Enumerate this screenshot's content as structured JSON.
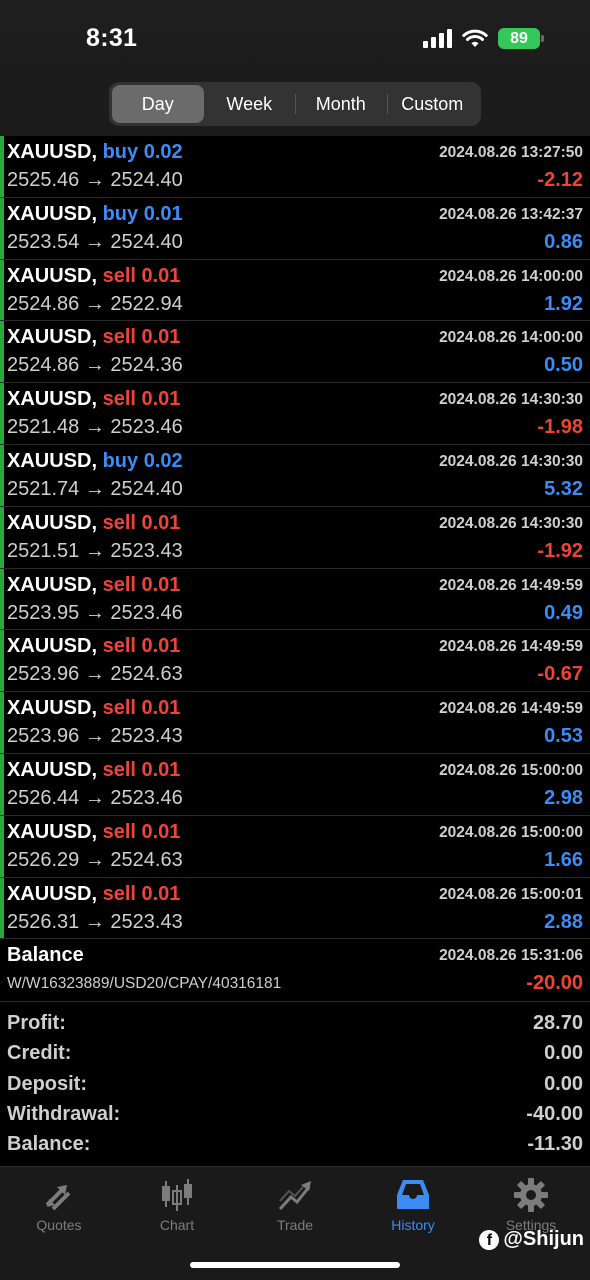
{
  "status_bar": {
    "time": "8:31",
    "battery": "89"
  },
  "period_tabs": [
    {
      "label": "Day",
      "active": true
    },
    {
      "label": "Week",
      "active": false
    },
    {
      "label": "Month",
      "active": false
    },
    {
      "label": "Custom",
      "active": false
    }
  ],
  "deals": [
    {
      "symbol": "XAUUSD,",
      "side": "buy",
      "volume": "0.02",
      "time": "2024.08.26 13:27:50",
      "prices": "2525.46 → 2524.40",
      "profit": "-2.12"
    },
    {
      "symbol": "XAUUSD,",
      "side": "buy",
      "volume": "0.01",
      "time": "2024.08.26 13:42:37",
      "prices": "2523.54 → 2524.40",
      "profit": "0.86"
    },
    {
      "symbol": "XAUUSD,",
      "side": "sell",
      "volume": "0.01",
      "time": "2024.08.26 14:00:00",
      "prices": "2524.86 → 2522.94",
      "profit": "1.92"
    },
    {
      "symbol": "XAUUSD,",
      "side": "sell",
      "volume": "0.01",
      "time": "2024.08.26 14:00:00",
      "prices": "2524.86 → 2524.36",
      "profit": "0.50"
    },
    {
      "symbol": "XAUUSD,",
      "side": "sell",
      "volume": "0.01",
      "time": "2024.08.26 14:30:30",
      "prices": "2521.48 → 2523.46",
      "profit": "-1.98"
    },
    {
      "symbol": "XAUUSD,",
      "side": "buy",
      "volume": "0.02",
      "time": "2024.08.26 14:30:30",
      "prices": "2521.74 → 2524.40",
      "profit": "5.32"
    },
    {
      "symbol": "XAUUSD,",
      "side": "sell",
      "volume": "0.01",
      "time": "2024.08.26 14:30:30",
      "prices": "2521.51 → 2523.43",
      "profit": "-1.92"
    },
    {
      "symbol": "XAUUSD,",
      "side": "sell",
      "volume": "0.01",
      "time": "2024.08.26 14:49:59",
      "prices": "2523.95 → 2523.46",
      "profit": "0.49"
    },
    {
      "symbol": "XAUUSD,",
      "side": "sell",
      "volume": "0.01",
      "time": "2024.08.26 14:49:59",
      "prices": "2523.96 → 2524.63",
      "profit": "-0.67"
    },
    {
      "symbol": "XAUUSD,",
      "side": "sell",
      "volume": "0.01",
      "time": "2024.08.26 14:49:59",
      "prices": "2523.96 → 2523.43",
      "profit": "0.53"
    },
    {
      "symbol": "XAUUSD,",
      "side": "sell",
      "volume": "0.01",
      "time": "2024.08.26 15:00:00",
      "prices": "2526.44 → 2523.46",
      "profit": "2.98"
    },
    {
      "symbol": "XAUUSD,",
      "side": "sell",
      "volume": "0.01",
      "time": "2024.08.26 15:00:00",
      "prices": "2526.29 → 2524.63",
      "profit": "1.66"
    },
    {
      "symbol": "XAUUSD,",
      "side": "sell",
      "volume": "0.01",
      "time": "2024.08.26 15:00:01",
      "prices": "2526.31 → 2523.43",
      "profit": "2.88"
    }
  ],
  "balance_entry": {
    "label": "Balance",
    "time": "2024.08.26 15:31:06",
    "comment": "W/W16323889/USD20/CPAY/40316181",
    "amount": "-20.00"
  },
  "summary": [
    {
      "label": "Profit:",
      "value": "28.70"
    },
    {
      "label": "Credit:",
      "value": "0.00"
    },
    {
      "label": "Deposit:",
      "value": "0.00"
    },
    {
      "label": "Withdrawal:",
      "value": "-40.00"
    },
    {
      "label": "Balance:",
      "value": "-11.30"
    }
  ],
  "tab_bar": [
    {
      "label": "Quotes",
      "icon": "quotes-arrows-icon",
      "active": false
    },
    {
      "label": "Chart",
      "icon": "candlestick-chart-icon",
      "active": false
    },
    {
      "label": "Trade",
      "icon": "trade-trend-icon",
      "active": false
    },
    {
      "label": "History",
      "icon": "history-inbox-icon",
      "active": true
    },
    {
      "label": "Settings",
      "icon": "gear-icon",
      "active": false
    }
  ],
  "watermark": "@Shijun",
  "colors": {
    "buy": "#3b8cf5",
    "sell": "#ee4438",
    "active_tab": "#3b8cf5",
    "row_marker": "#29a83c"
  }
}
